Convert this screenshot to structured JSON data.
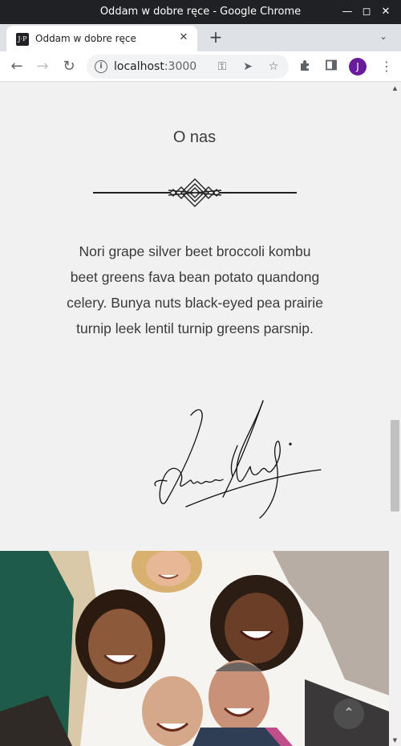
{
  "window": {
    "title": "Oddam w dobre ręce - Google Chrome",
    "minimize_icon": "minimize-icon",
    "maximize_icon": "maximize-icon",
    "close_icon": "close-icon"
  },
  "tabs": [
    {
      "label": "Oddam w dobre ręce",
      "favicon": "site-favicon",
      "favicon_text": "J·P"
    }
  ],
  "toolbar": {
    "url_host": "localhost",
    "url_port": ":3000",
    "profile_initial": "J"
  },
  "page": {
    "heading": "O nas",
    "paragraph": "Nori grape silver beet broccoli kombu beet greens fava bean potato quandong celery. Bunya nuts black-eyed pea prairie turnip leek lentil turnip greens parsnip.",
    "colors": {
      "background": "#f0f1f0",
      "text": "#3a3a3a",
      "ornament": "#222222"
    }
  }
}
